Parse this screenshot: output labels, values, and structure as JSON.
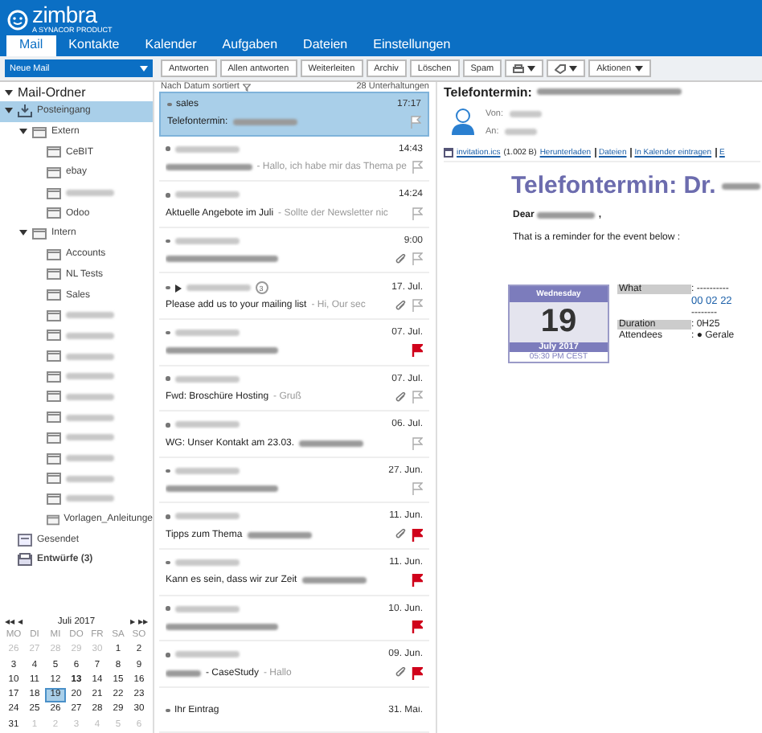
{
  "app": {
    "logo": "zimbra",
    "logo_tagline": "A SYNACOR PRODUCT"
  },
  "tabs": [
    {
      "label": "Mail",
      "selected": true
    },
    {
      "label": "Kontakte",
      "selected": false
    },
    {
      "label": "Kalender",
      "selected": false
    },
    {
      "label": "Aufgaben",
      "selected": false
    },
    {
      "label": "Dateien",
      "selected": false
    },
    {
      "label": "Einstellungen",
      "selected": false
    }
  ],
  "toolbar": {
    "new_mail": "Neue Mail",
    "buttons": [
      {
        "kind": "text",
        "label": "Antworten"
      },
      {
        "kind": "text",
        "label": "Allen antworten"
      },
      {
        "kind": "text",
        "label": "Weiterleiten"
      },
      {
        "kind": "text",
        "label": "Archiv"
      },
      {
        "kind": "text",
        "label": "Löschen"
      },
      {
        "kind": "text",
        "label": "Spam"
      },
      {
        "kind": "print"
      },
      {
        "kind": "tag"
      },
      {
        "kind": "menu",
        "label": "Aktionen"
      }
    ]
  },
  "folders": {
    "title": "Mail-Ordner",
    "expanded": true,
    "items": [
      {
        "label": "Posteingang",
        "kind": "inbox",
        "selected": true,
        "expanded": true,
        "children": [
          {
            "label": "Extern",
            "selected": false,
            "expanded": true,
            "children": [
              {
                "label": "CeBIT",
                "selected": false
              },
              {
                "label": "ebay",
                "selected": false
              },
              {
                "label_redacted": true,
                "selected": false
              },
              {
                "label": "Odoo",
                "selected": false
              }
            ]
          },
          {
            "label": "Intern",
            "selected": false,
            "expanded": true,
            "children": [
              {
                "label": "Accounts",
                "selected": false
              },
              {
                "label": "NL Tests",
                "selected": false
              },
              {
                "label": "Sales",
                "selected": false
              },
              {
                "label_redacted": true,
                "selected": false
              },
              {
                "label_redacted": true,
                "selected": false
              },
              {
                "label_redacted": true,
                "selected": false
              },
              {
                "label_redacted": true,
                "selected": false
              },
              {
                "label_redacted": true,
                "selected": false
              },
              {
                "label_redacted": true,
                "selected": false
              },
              {
                "label_redacted": true,
                "selected": false
              },
              {
                "label_redacted": true,
                "selected": false
              },
              {
                "label_redacted": true,
                "selected": false
              },
              {
                "label_redacted": true,
                "selected": false
              },
              {
                "label": "Vorlagen_Anleitunge",
                "selected": false
              }
            ]
          }
        ]
      },
      {
        "label": "Gesendet",
        "kind": "sent",
        "selected": false
      },
      {
        "label": "Entwürfe (3)",
        "kind": "drafts",
        "selected": false,
        "unread": true
      }
    ]
  },
  "mini_calendar": {
    "month": "Juli 2017",
    "prev_year": "◀◀",
    "prev": "◀",
    "next": "▶",
    "next_year": "▶▶",
    "weekdays": [
      "MO",
      "DI",
      "MI",
      "DO",
      "FR",
      "SA",
      "SO"
    ],
    "weeks": [
      [
        {
          "day": "26",
          "other_month": true,
          "selected": false
        },
        {
          "day": "27",
          "other_month": true,
          "selected": false
        },
        {
          "day": "28",
          "other_month": true,
          "selected": false
        },
        {
          "day": "29",
          "other_month": true,
          "selected": false
        },
        {
          "day": "30",
          "other_month": true,
          "selected": false
        },
        {
          "day": "1",
          "selected": false
        },
        {
          "day": "2",
          "selected": false
        }
      ],
      [
        {
          "day": "3",
          "selected": false
        },
        {
          "day": "4",
          "selected": false
        },
        {
          "day": "5",
          "selected": false
        },
        {
          "day": "6",
          "selected": false
        },
        {
          "day": "7",
          "selected": false
        },
        {
          "day": "8",
          "selected": false
        },
        {
          "day": "9",
          "selected": false
        }
      ],
      [
        {
          "day": "10",
          "selected": false
        },
        {
          "day": "11",
          "selected": false
        },
        {
          "day": "12",
          "selected": false
        },
        {
          "day": "13",
          "today": true,
          "selected": false
        },
        {
          "day": "14",
          "selected": false
        },
        {
          "day": "15",
          "selected": false
        },
        {
          "day": "16",
          "selected": false
        }
      ],
      [
        {
          "day": "17",
          "selected": false
        },
        {
          "day": "18",
          "selected": false
        },
        {
          "day": "19",
          "selected": true
        },
        {
          "day": "20",
          "selected": false
        },
        {
          "day": "21",
          "selected": false
        },
        {
          "day": "22",
          "selected": false
        },
        {
          "day": "23",
          "selected": false
        }
      ],
      [
        {
          "day": "24",
          "selected": false
        },
        {
          "day": "25",
          "selected": false
        },
        {
          "day": "26",
          "selected": false
        },
        {
          "day": "27",
          "selected": false
        },
        {
          "day": "28",
          "selected": false
        },
        {
          "day": "29",
          "selected": false
        },
        {
          "day": "30",
          "selected": false
        }
      ],
      [
        {
          "day": "31",
          "selected": false
        },
        {
          "day": "1",
          "other_month": true,
          "selected": false
        },
        {
          "day": "2",
          "other_month": true,
          "selected": false
        },
        {
          "day": "3",
          "other_month": true,
          "selected": false
        },
        {
          "day": "4",
          "other_month": true,
          "selected": false
        },
        {
          "day": "5",
          "other_month": true,
          "selected": false
        },
        {
          "day": "6",
          "other_month": true,
          "selected": false
        }
      ]
    ]
  },
  "message_list": {
    "sort": "Nach Datum sortiert",
    "count": "28 Unterhaltungen",
    "messages": [
      {
        "sender": "sales",
        "time": "17:17",
        "subject": "Telefontermin:",
        "subject_redacted": true,
        "selected": true,
        "flagged": false,
        "attachment": false
      },
      {
        "sender_redacted": true,
        "time": "14:43",
        "subject_redacted": true,
        "snippet": " - Hallo, ich habe mir das Thema pe",
        "selected": false,
        "flagged": false,
        "attachment": false
      },
      {
        "sender_redacted": true,
        "time": "14:24",
        "subject": "Aktuelle Angebote im Juli",
        "snippet": " - Sollte der Newsletter nic",
        "selected": false,
        "flagged": false,
        "attachment": false
      },
      {
        "sender_redacted": true,
        "time": "9:00",
        "subject_redacted": true,
        "selected": false,
        "flagged": false,
        "attachment": true
      },
      {
        "sender_redacted": true,
        "thread": true,
        "thread_count": "3",
        "time": "17. Jul.",
        "subject": "Please add us to your mailing list",
        "snippet": " - Hi, Our sec",
        "selected": false,
        "flagged": false,
        "attachment": true
      },
      {
        "sender_redacted": true,
        "time": "07. Jul.",
        "subject_redacted": true,
        "selected": false,
        "flagged": true,
        "attachment": false
      },
      {
        "sender_redacted": true,
        "time": "07. Jul.",
        "subject": "Fwd: Broschüre Hosting",
        "snippet": " - Gruß",
        "selected": false,
        "flagged": false,
        "attachment": true
      },
      {
        "sender_redacted": true,
        "time": "06. Jul.",
        "subject": "WG: Unser Kontakt am 23.03.",
        "subject_redacted": true,
        "selected": false,
        "flagged": false,
        "attachment": false
      },
      {
        "sender_redacted": true,
        "time": "27. Jun.",
        "subject_redacted": true,
        "selected": false,
        "flagged": false,
        "attachment": false
      },
      {
        "sender_redacted": true,
        "time": "11. Jun.",
        "subject": "Tipps zum Thema",
        "subject_redacted": true,
        "selected": false,
        "flagged": true,
        "attachment": true
      },
      {
        "sender_redacted": true,
        "time": "11. Jun.",
        "subject": "Kann es sein, dass wir zur Zeit",
        "subject_redacted": true,
        "selected": false,
        "flagged": true,
        "attachment": false
      },
      {
        "sender_redacted": true,
        "time": "10. Jun.",
        "subject_redacted": true,
        "selected": false,
        "flagged": true,
        "attachment": false
      },
      {
        "sender_redacted": true,
        "time": "09. Jun.",
        "subject": " - CaseStudy",
        "subject_prefix_redacted": true,
        "snippet": " - Hallo",
        "selected": false,
        "flagged": true,
        "attachment": true
      },
      {
        "sender": "Ihr Eintrag",
        "time": "31. Mai.",
        "selected": false
      }
    ]
  },
  "reading_pane": {
    "title": "Telefontermin:",
    "title_redacted": true,
    "from_label": "Von:",
    "to_label": "An:",
    "attachment": {
      "file": "invitation.ics",
      "size": "(1.002 B)",
      "links": [
        "Herunterladen",
        "Dateien",
        "In Kalender eintragen",
        "E"
      ]
    },
    "heading": "Telefontermin: Dr.",
    "greeting": "Dear",
    "greeting_end": ",",
    "intro": "That is a reminder for the event below :",
    "event_card": {
      "weekday": "Wednesday",
      "day": "19",
      "month": "July 2017",
      "time": "05:30 PM CEST"
    },
    "details": [
      {
        "label": "What",
        "value": ": ----------",
        "highlighted": true,
        "kind": "text"
      },
      {
        "value": "00 02 22",
        "kind": "link"
      },
      {
        "value": "--------",
        "kind": "text"
      },
      {
        "label": "Duration",
        "value": ": 0H25",
        "highlighted": true,
        "kind": "text"
      },
      {
        "label": "Attendees",
        "value": ": ● Gerale",
        "highlighted": false,
        "kind": "text"
      }
    ]
  }
}
